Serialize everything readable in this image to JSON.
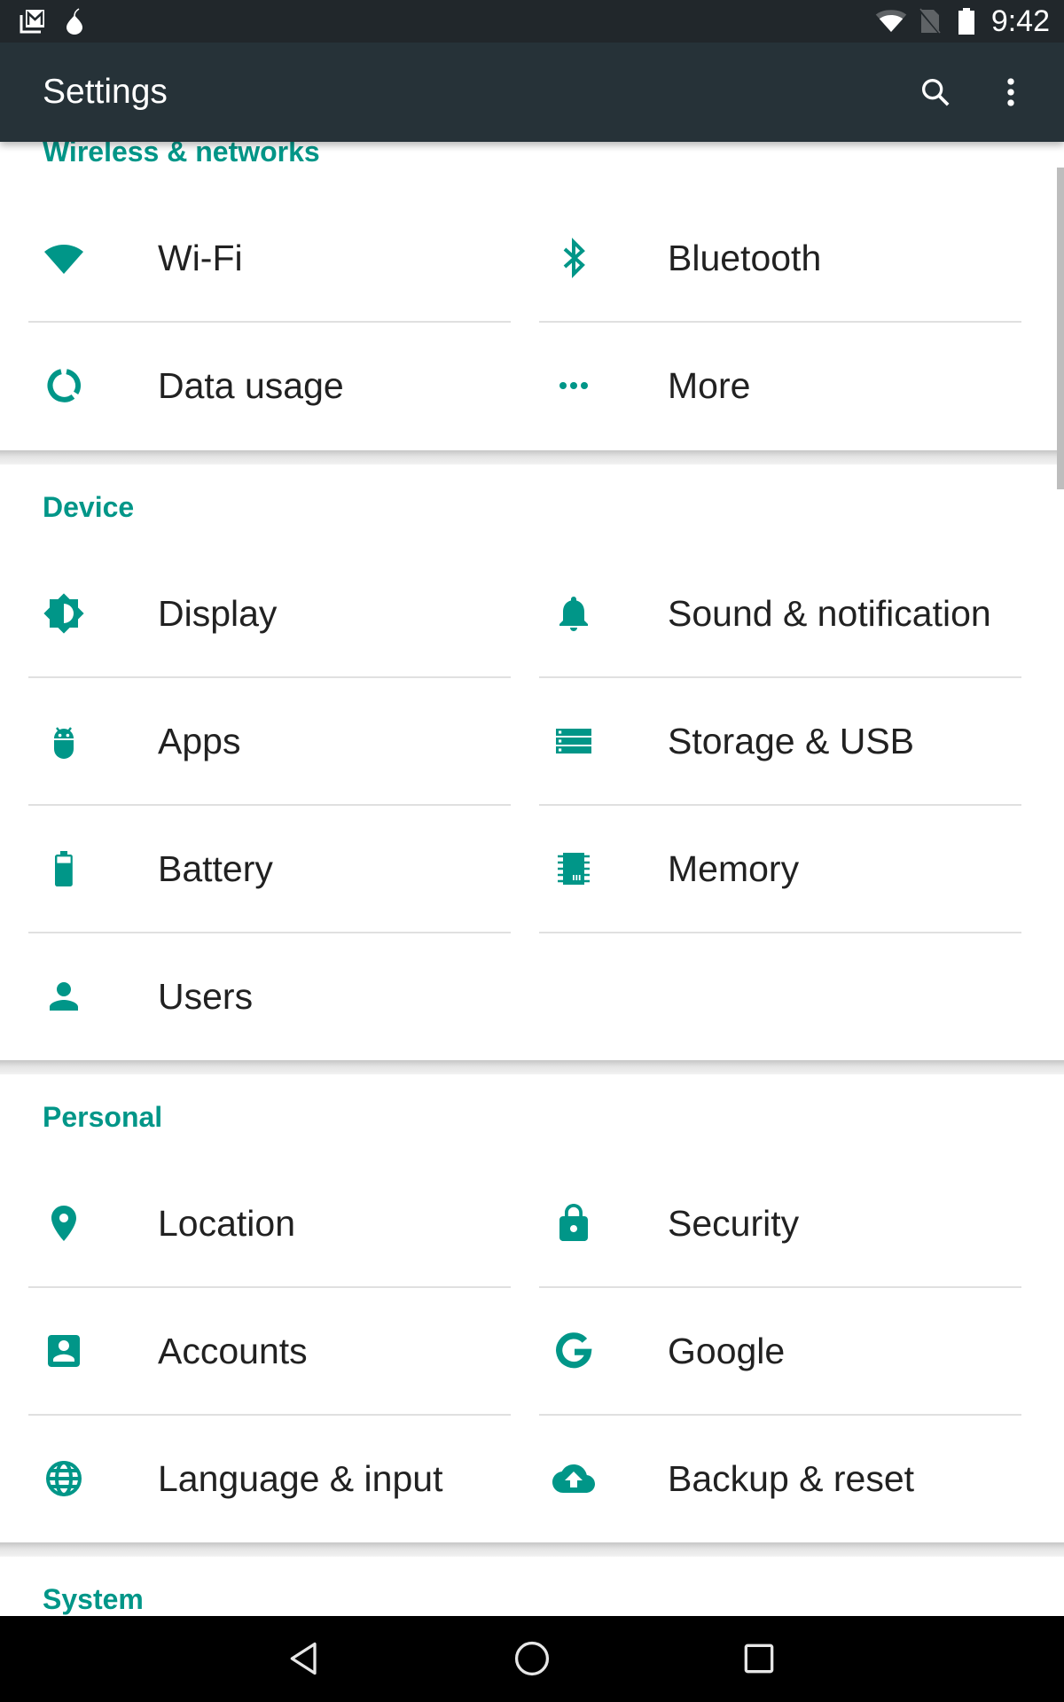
{
  "status_bar": {
    "time": "9:42",
    "left_icons": [
      "gmail-notification-icon",
      "tor-onion-notification-icon"
    ],
    "right_icons": [
      "wifi-signal-icon",
      "no-sim-icon",
      "battery-full-icon"
    ]
  },
  "toolbar": {
    "title": "Settings",
    "actions": [
      {
        "name": "search",
        "icon": "search-icon"
      },
      {
        "name": "more-options",
        "icon": "overflow-menu-icon"
      }
    ]
  },
  "theme": {
    "accent": "#009688",
    "toolbar_bg": "#263238",
    "status_bar_bg": "#21272b",
    "text_primary": "#212121",
    "divider": "#e0e0e0"
  },
  "sections": [
    {
      "title": "Wireless & networks",
      "items": [
        {
          "label": "Wi-Fi",
          "icon": "wifi-icon"
        },
        {
          "label": "Bluetooth",
          "icon": "bluetooth-icon"
        },
        {
          "label": "Data usage",
          "icon": "data-usage-icon"
        },
        {
          "label": "More",
          "icon": "more-horiz-icon"
        }
      ]
    },
    {
      "title": "Device",
      "items": [
        {
          "label": "Display",
          "icon": "brightness-icon"
        },
        {
          "label": "Sound & notification",
          "icon": "bell-icon"
        },
        {
          "label": "Apps",
          "icon": "android-icon"
        },
        {
          "label": "Storage & USB",
          "icon": "storage-icon"
        },
        {
          "label": "Battery",
          "icon": "battery-icon"
        },
        {
          "label": "Memory",
          "icon": "memory-chip-icon"
        },
        {
          "label": "Users",
          "icon": "person-icon"
        }
      ]
    },
    {
      "title": "Personal",
      "items": [
        {
          "label": "Location",
          "icon": "location-pin-icon"
        },
        {
          "label": "Security",
          "icon": "lock-icon"
        },
        {
          "label": "Accounts",
          "icon": "account-box-icon"
        },
        {
          "label": "Google",
          "icon": "google-g-icon"
        },
        {
          "label": "Language & input",
          "icon": "globe-icon"
        },
        {
          "label": "Backup & reset",
          "icon": "cloud-upload-icon"
        }
      ]
    },
    {
      "title": "System",
      "items": []
    }
  ],
  "nav_bar": {
    "buttons": [
      {
        "name": "back",
        "icon": "back-triangle-icon"
      },
      {
        "name": "home",
        "icon": "home-circle-icon"
      },
      {
        "name": "recents",
        "icon": "recents-square-icon"
      }
    ]
  }
}
